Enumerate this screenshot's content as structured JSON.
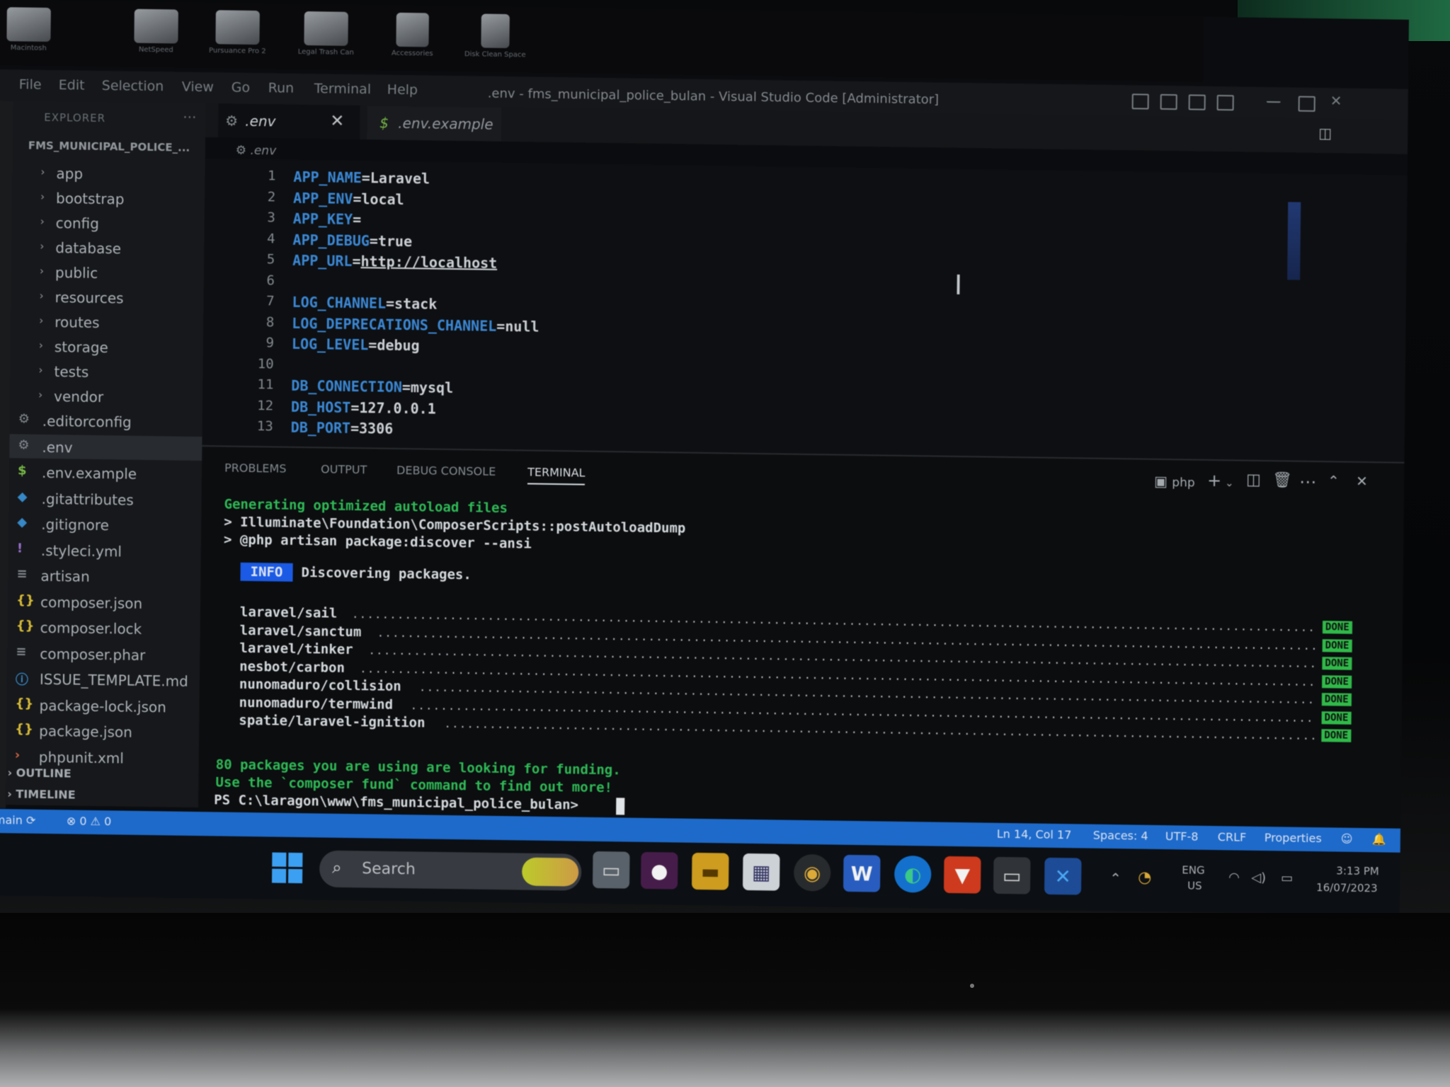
{
  "desktop_icons": [
    {
      "label": "Macintosh"
    },
    {
      "label": "NetSpeed"
    },
    {
      "label": "Pursuance Pro 2"
    },
    {
      "label": "Legal Trash Can"
    },
    {
      "label": "Accessories"
    },
    {
      "label": "Disk Clean Space"
    }
  ],
  "window": {
    "menus": [
      "File",
      "Edit",
      "Selection",
      "View",
      "Go",
      "Run",
      "Terminal",
      "Help"
    ],
    "title": ".env - fms_municipal_police_bulan - Visual Studio Code [Administrator]"
  },
  "sidebar": {
    "title": "EXPLORER",
    "more": "···",
    "project": "FMS_MUNICIPAL_POLICE_...",
    "folders": [
      "app",
      "bootstrap",
      "config",
      "database",
      "public",
      "resources",
      "routes",
      "storage",
      "tests",
      "vendor"
    ],
    "files": [
      {
        "name": ".editorconfig",
        "icon": "⚙",
        "color": "#8b9197"
      },
      {
        "name": ".env",
        "icon": "⚙",
        "color": "#8b9197"
      },
      {
        "name": ".env.example",
        "icon": "$",
        "color": "#7ec24a"
      },
      {
        "name": ".gitattributes",
        "icon": "◆",
        "color": "#3a8fd1"
      },
      {
        "name": ".gitignore",
        "icon": "◆",
        "color": "#3a8fd1"
      },
      {
        "name": ".styleci.yml",
        "icon": "!",
        "color": "#a173d8"
      },
      {
        "name": "artisan",
        "icon": "≡",
        "color": "#8b9197"
      },
      {
        "name": "composer.json",
        "icon": "{}",
        "color": "#e3c53a"
      },
      {
        "name": "composer.lock",
        "icon": "{}",
        "color": "#e3c53a"
      },
      {
        "name": "composer.phar",
        "icon": "≡",
        "color": "#8b9197"
      },
      {
        "name": "ISSUE_TEMPLATE.md",
        "icon": "ⓘ",
        "color": "#3a8fd1"
      },
      {
        "name": "package-lock.json",
        "icon": "{}",
        "color": "#e3c53a"
      },
      {
        "name": "package.json",
        "icon": "{}",
        "color": "#e3c53a"
      },
      {
        "name": "phpunit.xml",
        "icon": "›",
        "color": "#e06c4a"
      }
    ],
    "outline": "OUTLINE",
    "timeline": "TIMELINE"
  },
  "tabs": [
    {
      "label": ".env",
      "icon": "⚙",
      "color": "#8b9197",
      "active": true
    },
    {
      "label": ".env.example",
      "icon": "$",
      "color": "#7ec24a",
      "active": false
    }
  ],
  "breadcrumb": ".env",
  "editor": {
    "lines": [
      {
        "n": "1",
        "key": "APP_NAME",
        "val": "=Laravel",
        "link": ""
      },
      {
        "n": "2",
        "key": "APP_ENV",
        "val": "=local",
        "link": ""
      },
      {
        "n": "3",
        "key": "APP_KEY",
        "val": "=",
        "link": ""
      },
      {
        "n": "4",
        "key": "APP_DEBUG",
        "val": "=true",
        "link": ""
      },
      {
        "n": "5",
        "key": "APP_URL",
        "val": "=",
        "link": "http://localhost"
      },
      {
        "n": "6",
        "key": "",
        "val": "",
        "link": ""
      },
      {
        "n": "7",
        "key": "LOG_CHANNEL",
        "val": "=stack",
        "link": ""
      },
      {
        "n": "8",
        "key": "LOG_DEPRECATIONS_CHANNEL",
        "val": "=null",
        "link": ""
      },
      {
        "n": "9",
        "key": "LOG_LEVEL",
        "val": "=debug",
        "link": ""
      },
      {
        "n": "10",
        "key": "",
        "val": "",
        "link": ""
      },
      {
        "n": "11",
        "key": "DB_CONNECTION",
        "val": "=mysql",
        "link": ""
      },
      {
        "n": "12",
        "key": "DB_HOST",
        "val": "=127.0.0.1",
        "link": ""
      },
      {
        "n": "13",
        "key": "DB_PORT",
        "val": "=3306",
        "link": ""
      }
    ]
  },
  "panel": {
    "tabs": [
      "PROBLEMS",
      "OUTPUT",
      "DEBUG CONSOLE",
      "TERMINAL"
    ],
    "active_tab": "TERMINAL",
    "shell": "php",
    "terminal": {
      "line1": "Generating optimized autoload files",
      "line2": "> Illuminate\\Foundation\\ComposerScripts::postAutoloadDump",
      "line3": "> @php artisan package:discover --ansi",
      "info_badge": "INFO",
      "info_text": "Discovering packages.",
      "packages": [
        {
          "name": "laravel/sail",
          "status": "DONE"
        },
        {
          "name": "laravel/sanctum",
          "status": "DONE"
        },
        {
          "name": "laravel/tinker",
          "status": "DONE"
        },
        {
          "name": "nesbot/carbon",
          "status": "DONE"
        },
        {
          "name": "nunomaduro/collision",
          "status": "DONE"
        },
        {
          "name": "nunomaduro/termwind",
          "status": "DONE"
        },
        {
          "name": "spatie/laravel-ignition",
          "status": "DONE"
        }
      ],
      "funding1": "80 packages you are using are looking for funding.",
      "funding2": "Use the `composer fund` command to find out more!",
      "prompt": "PS C:\\laragon\\www\\fms_municipal_police_bulan> "
    }
  },
  "statusbar": {
    "branch": "main",
    "problems": "⊗ 0 ⚠ 0",
    "position": "Ln 14, Col 17",
    "spaces": "Spaces: 4",
    "encoding": "UTF-8",
    "eol": "CRLF",
    "language": "Properties"
  },
  "taskbar": {
    "search": "Search",
    "lang1": "ENG",
    "lang2": "US",
    "time": "3:13 PM",
    "date": "16/07/2023"
  },
  "colors": {
    "statusbar": "#1f70d6",
    "info_badge": "#1c5ff0",
    "done": "#33c44d",
    "terminal_green": "#31c35a",
    "env_key": "#3e8fe0"
  }
}
